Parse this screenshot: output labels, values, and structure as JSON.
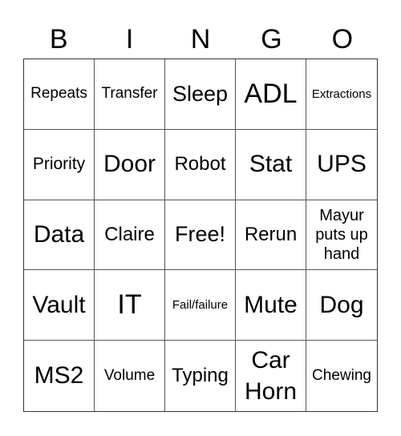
{
  "header": {
    "letters": [
      "B",
      "I",
      "N",
      "G",
      "O"
    ]
  },
  "cells": [
    "Repeats",
    "Transfer",
    "Sleep",
    "ADL",
    "Extractions",
    "Priority",
    "Door",
    "Robot",
    "Stat",
    "UPS",
    "Data",
    "Claire",
    "Free!",
    "Rerun",
    "Mayur puts up hand",
    "Vault",
    "IT",
    "Fail/failure",
    "Mute",
    "Dog",
    "MS2",
    "Volume",
    "Typing",
    "Car Horn",
    "Chewing"
  ]
}
